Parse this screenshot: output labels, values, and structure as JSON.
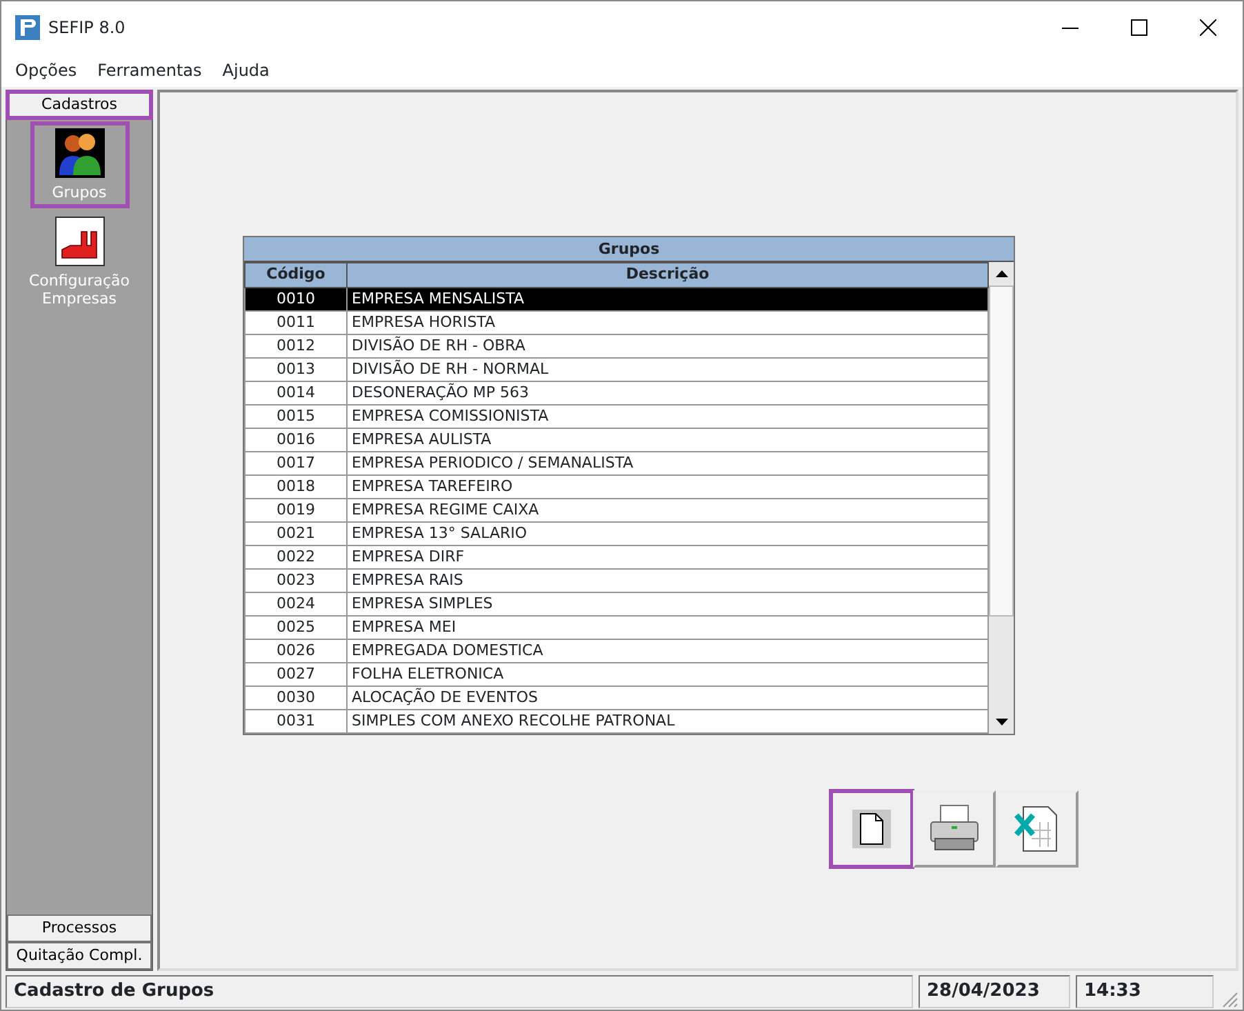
{
  "window": {
    "title": "SEFIP 8.0"
  },
  "menu": [
    "Opções",
    "Ferramentas",
    "Ajuda"
  ],
  "sidebar": {
    "sections": [
      {
        "label": "Cadastros",
        "highlighted": true,
        "expanded": true,
        "items": [
          {
            "kind": "groups",
            "label": "Grupos",
            "highlighted": true
          },
          {
            "kind": "companies",
            "label": "Configuração Empresas",
            "highlighted": false
          }
        ]
      },
      {
        "label": "Processos",
        "highlighted": false,
        "expanded": false
      },
      {
        "label": "Quitação Compl.",
        "highlighted": false,
        "expanded": false
      }
    ]
  },
  "table": {
    "title": "Grupos",
    "columns": [
      "Código",
      "Descrição"
    ],
    "rows": [
      {
        "cells": [
          "0010",
          "EMPRESA MENSALISTA"
        ],
        "selected": true
      },
      {
        "cells": [
          "0011",
          "EMPRESA HORISTA"
        ],
        "selected": false
      },
      {
        "cells": [
          "0012",
          "DIVISÃO DE RH - OBRA"
        ],
        "selected": false
      },
      {
        "cells": [
          "0013",
          "DIVISÃO DE RH - NORMAL"
        ],
        "selected": false
      },
      {
        "cells": [
          "0014",
          "DESONERAÇÃO MP 563"
        ],
        "selected": false
      },
      {
        "cells": [
          "0015",
          "EMPRESA COMISSIONISTA"
        ],
        "selected": false
      },
      {
        "cells": [
          "0016",
          "EMPRESA AULISTA"
        ],
        "selected": false
      },
      {
        "cells": [
          "0017",
          "EMPRESA PERIODICO / SEMANALISTA"
        ],
        "selected": false
      },
      {
        "cells": [
          "0018",
          "EMPRESA TAREFEIRO"
        ],
        "selected": false
      },
      {
        "cells": [
          "0019",
          "EMPRESA REGIME CAIXA"
        ],
        "selected": false
      },
      {
        "cells": [
          "0021",
          "EMPRESA 13° SALARIO"
        ],
        "selected": false
      },
      {
        "cells": [
          "0022",
          "EMPRESA DIRF"
        ],
        "selected": false
      },
      {
        "cells": [
          "0023",
          "EMPRESA RAIS"
        ],
        "selected": false
      },
      {
        "cells": [
          "0024",
          "EMPRESA SIMPLES"
        ],
        "selected": false
      },
      {
        "cells": [
          "0025",
          "EMPRESA MEI"
        ],
        "selected": false
      },
      {
        "cells": [
          "0026",
          "EMPREGADA DOMESTICA"
        ],
        "selected": false
      },
      {
        "cells": [
          "0027",
          "FOLHA ELETRONICA"
        ],
        "selected": false
      },
      {
        "cells": [
          "0030",
          "ALOCAÇÃO DE EVENTOS"
        ],
        "selected": false
      },
      {
        "cells": [
          "0031",
          "SIMPLES COM ANEXO RECOLHE PATRONAL"
        ],
        "selected": false
      }
    ]
  },
  "toolbar": [
    {
      "kind": "new",
      "highlighted": true
    },
    {
      "kind": "print",
      "highlighted": false
    },
    {
      "kind": "excel",
      "highlighted": false
    }
  ],
  "status_bar": {
    "message": "Cadastro de Grupos",
    "date": "28/04/2023",
    "time": "14:33"
  }
}
